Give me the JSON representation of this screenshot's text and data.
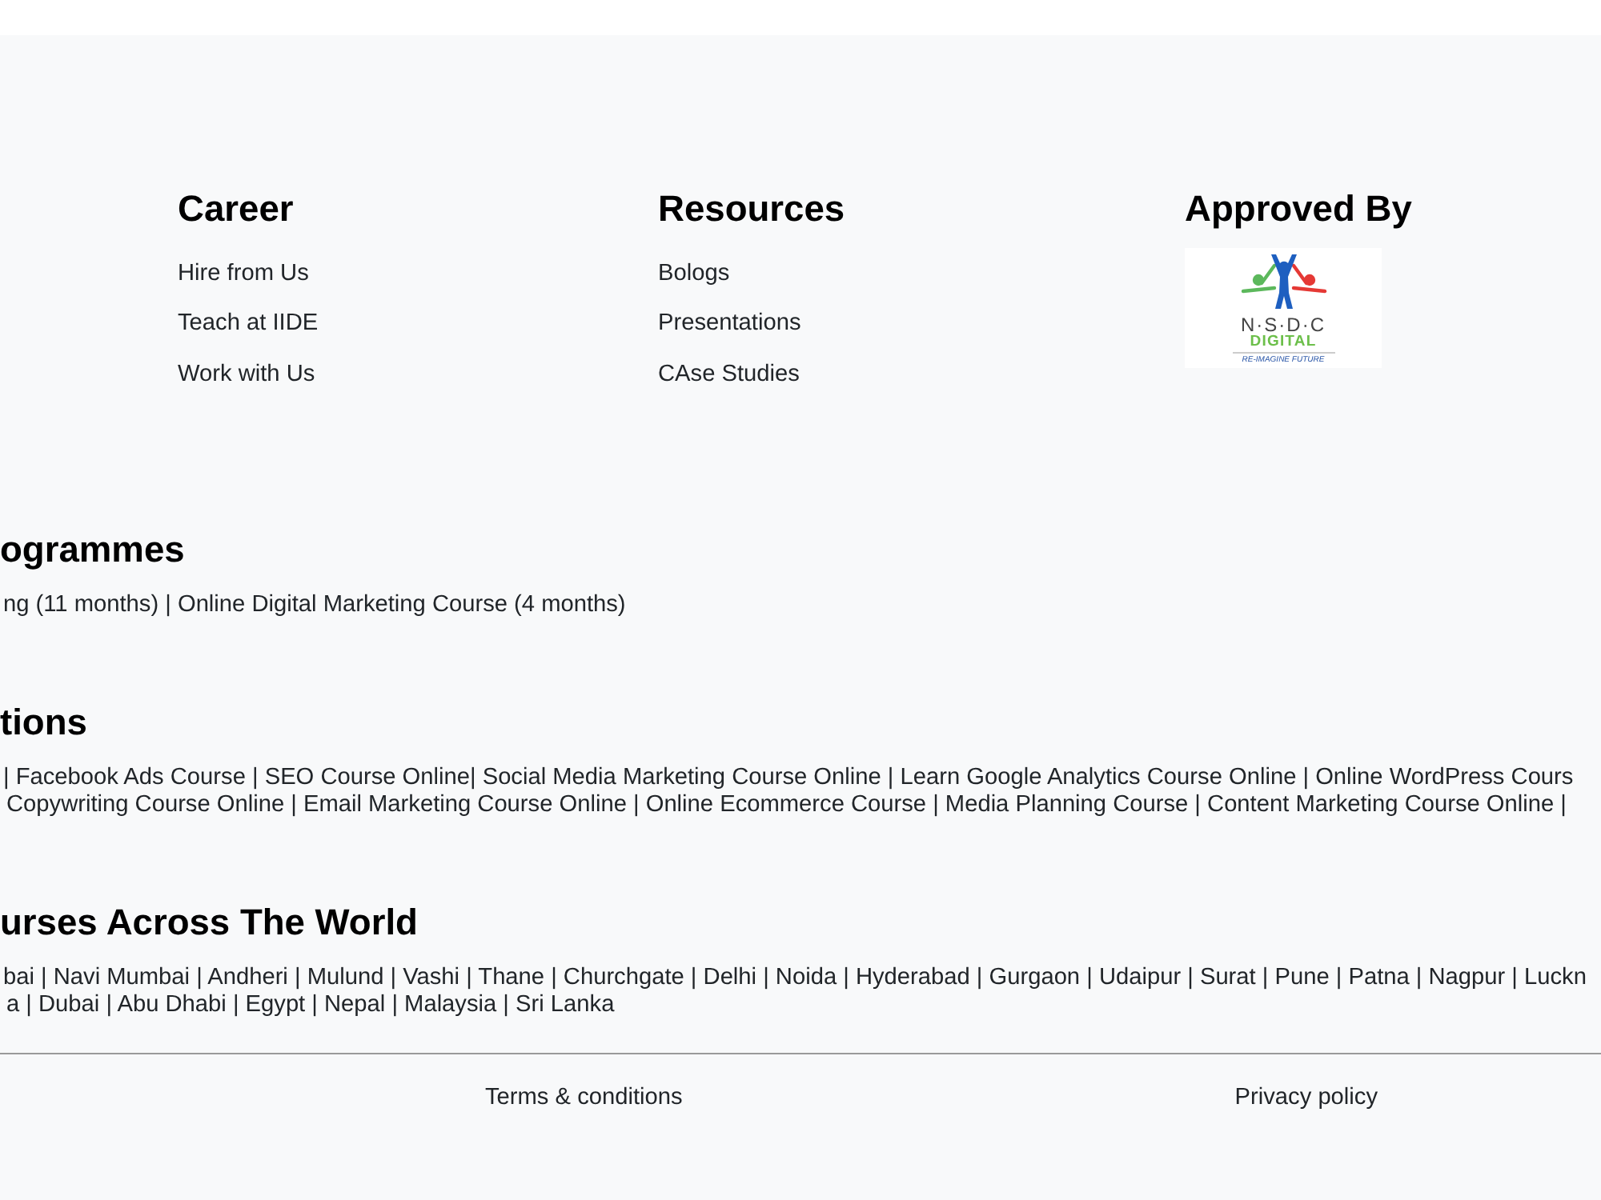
{
  "footer": {
    "columns": [
      {
        "title": "Career",
        "links": [
          "Hire from Us",
          "Teach at IIDE",
          "Work with Us"
        ]
      },
      {
        "title": "Resources",
        "links": [
          "Bologs",
          "Presentations",
          "CAse Studies"
        ]
      }
    ],
    "approved_by": {
      "title": "Approved By",
      "logo": {
        "name": "N·S·D·C",
        "subtitle": "DIGITAL",
        "tagline": "RE-IMAGINE FUTURE"
      }
    },
    "sections": [
      {
        "title": "ogrammes",
        "lines": [
          "ng (11 months) | Online Digital Marketing Course (4 months)"
        ]
      },
      {
        "title": "tions",
        "lines": [
          "| Facebook Ads Course | SEO Course Online| Social Media Marketing Course Online | Learn Google Analytics Course Online | Online WordPress Cours",
          "Copywriting Course Online | Email Marketing Course Online | Online Ecommerce Course | Media Planning Course | Content Marketing Course Online |"
        ]
      },
      {
        "title": "urses Across The World",
        "lines": [
          "bai | Navi Mumbai | Andheri | Mulund | Vashi | Thane | Churchgate | Delhi | Noida | Hyderabad | Gurgaon | Udaipur | Surat | Pune | Patna | Nagpur | Luckn",
          "a | Dubai | Abu Dhabi | Egypt | Nepal | Malaysia | Sri Lanka"
        ]
      }
    ],
    "bottom_links": [
      "Terms & conditions",
      "Privacy policy"
    ]
  }
}
